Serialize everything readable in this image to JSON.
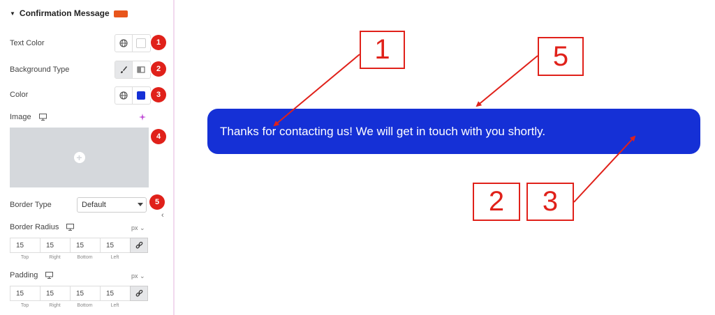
{
  "panel": {
    "section_title": "Confirmation Message",
    "text_color_label": "Text Color",
    "background_type_label": "Background Type",
    "color_label": "Color",
    "image_label": "Image",
    "border_type_label": "Border Type",
    "border_type_value": "Default",
    "border_radius_label": "Border Radius",
    "border_radius_unit": "px",
    "border_radius": {
      "top": "15",
      "right": "15",
      "bottom": "15",
      "left": "15"
    },
    "padding_label": "Padding",
    "padding_unit": "px",
    "padding": {
      "top": "15",
      "right": "15",
      "bottom": "15",
      "left": "15"
    },
    "dim_captions": {
      "top": "Top",
      "right": "Right",
      "bottom": "Bottom",
      "left": "Left"
    },
    "badges": [
      "1",
      "2",
      "3",
      "4",
      "5"
    ]
  },
  "preview": {
    "message": "Thanks for contacting us! We will get in touch with you shortly.",
    "message_bg": "#1530d6",
    "callouts": [
      "1",
      "5",
      "2",
      "3"
    ]
  },
  "colors": {
    "accent_red": "#e0211a",
    "swatch_blue": "#1530d6",
    "pro_badge": "#e8551b"
  }
}
